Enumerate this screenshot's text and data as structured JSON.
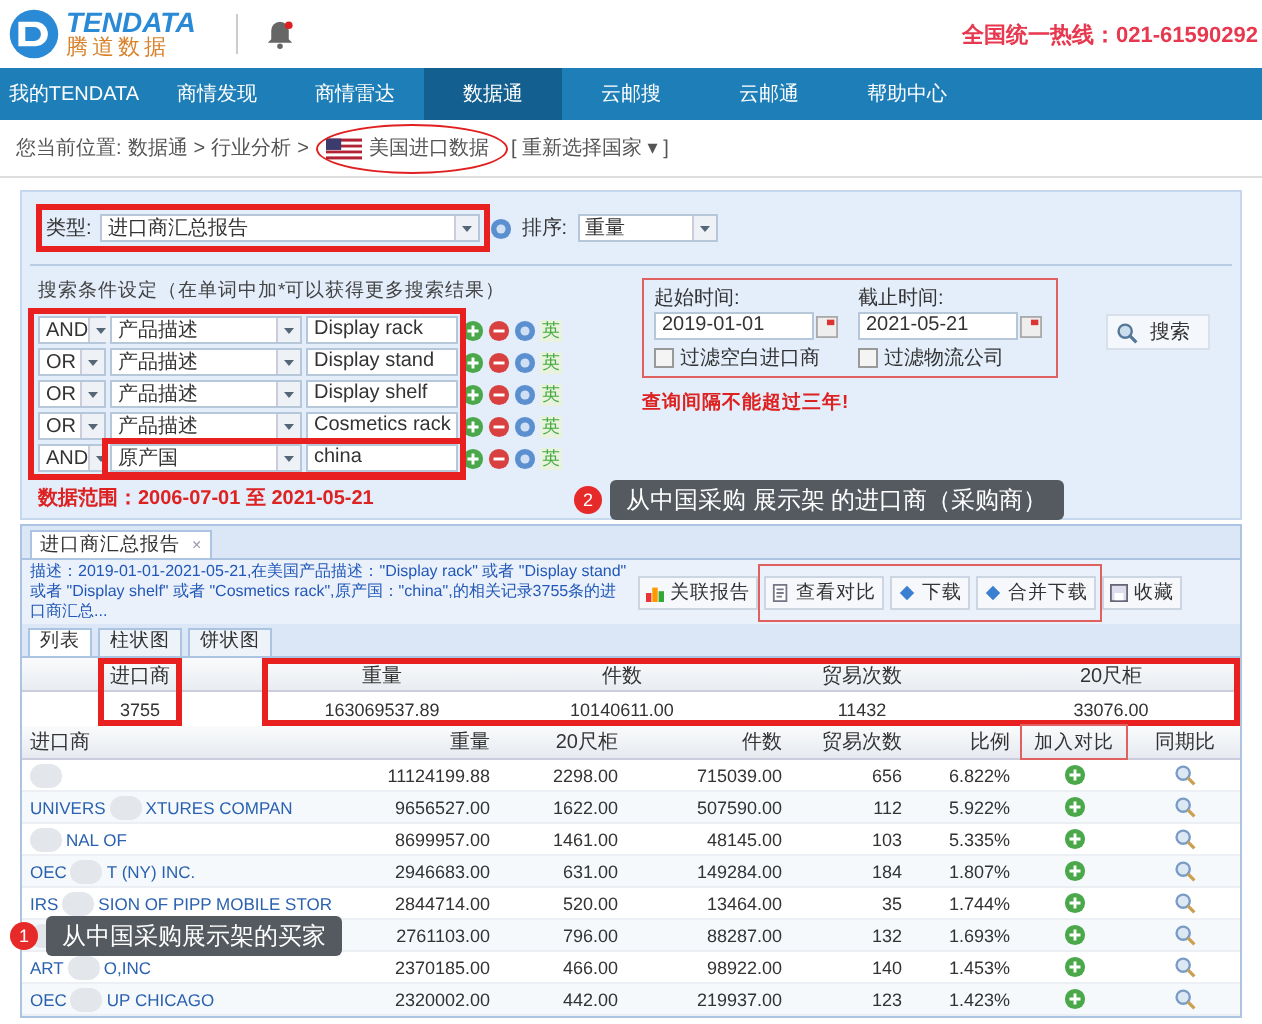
{
  "header": {
    "logo_en": "TENDATA",
    "logo_cn": "腾道数据",
    "hotline": "全国统一热线：021-61590292"
  },
  "nav": [
    {
      "label": "我的TENDATA",
      "selected": false
    },
    {
      "label": "商情发现",
      "selected": false
    },
    {
      "label": "商情雷达",
      "selected": false
    },
    {
      "label": "数据通",
      "selected": true
    },
    {
      "label": "云邮搜",
      "selected": false
    },
    {
      "label": "云邮通",
      "selected": false
    },
    {
      "label": "帮助中心",
      "selected": false
    }
  ],
  "breadcrumb": [
    {
      "kind": "text",
      "text": "您当前位置:"
    },
    {
      "kind": "link",
      "text": "数据通"
    },
    {
      "kind": "text",
      "text": ">"
    },
    {
      "kind": "link",
      "text": "行业分析"
    },
    {
      "kind": "text",
      "text": ">"
    },
    {
      "kind": "flag"
    },
    {
      "kind": "text",
      "text": "美国进口数据"
    },
    {
      "kind": "link",
      "text": "[ 重新选择国家 ▾ ]"
    }
  ],
  "filters": {
    "type_label": "类型:",
    "type_value": "进口商汇总报告",
    "sort_label": "排序:",
    "sort_value": "重量"
  },
  "conditions": {
    "title": "搜索条件设定（在单词中加*可以获得更多搜索结果）",
    "rows": [
      {
        "logic": "AND",
        "field": "产品描述",
        "value": "Display rack",
        "lang": "英"
      },
      {
        "logic": "OR",
        "field": "产品描述",
        "value": "Display stand",
        "lang": "英"
      },
      {
        "logic": "OR",
        "field": "产品描述",
        "value": "Display shelf",
        "lang": "英"
      },
      {
        "logic": "OR",
        "field": "产品描述",
        "value": "Cosmetics rack",
        "lang": "英"
      },
      {
        "logic": "AND",
        "field": "原产国",
        "value": "china",
        "lang": "英"
      }
    ]
  },
  "dates": {
    "start_label": "起始时间:",
    "start": "2019-01-01",
    "end_label": "截止时间:",
    "end": "2021-05-21",
    "options": [
      {
        "label": "过滤空白进口商",
        "checked": false
      },
      {
        "label": "过滤物流公司",
        "checked": false
      }
    ],
    "warning": "查询间隔不能超过三年!"
  },
  "search_button": "搜索",
  "data_range": "数据范围：2006-07-01 至 2021-05-21",
  "report": {
    "tab": "进口商汇总报告",
    "close": "×",
    "description": "描述：2019-01-01-2021-05-21,在美国产品描述：\"Display rack\" 或者 \"Display stand\" 或者 \"Display shelf\" 或者 \"Cosmetics rack\",原产国：\"china\",的相关记录3755条的进口商汇总...",
    "buttons": [
      {
        "label": "关联报告",
        "kind": "chart"
      },
      {
        "label": "查看对比",
        "kind": "doc"
      },
      {
        "label": "下载",
        "kind": "download"
      },
      {
        "label": "合并下载",
        "kind": "download"
      },
      {
        "label": "收藏",
        "kind": "save"
      }
    ]
  },
  "view_tabs": [
    {
      "label": "列表",
      "selected": true
    },
    {
      "label": "柱状图",
      "selected": false
    },
    {
      "label": "饼状图",
      "selected": false
    }
  ],
  "summary": {
    "columns": [
      "进口商",
      "重量",
      "件数",
      "贸易次数",
      "20尺柜"
    ],
    "values": [
      "3755",
      "163069537.89",
      "10140611.00",
      "11432",
      "33076.00"
    ]
  },
  "table": {
    "columns": [
      "进口商",
      "重量",
      "20尺柜",
      "件数",
      "贸易次数",
      "比例",
      "加入对比",
      "同期比"
    ],
    "rows": [
      {
        "weight": "11124199.88",
        "teu": "2298.00",
        "pieces": "715039.00",
        "trades": "656",
        "share": "6.822%"
      },
      {
        "name_start": "UNIVERS",
        "name_end": "XTURES COMPAN",
        "weight": "9656527.00",
        "teu": "1622.00",
        "pieces": "507590.00",
        "trades": "112",
        "share": "5.922%"
      },
      {
        "name_end": "NAL OF",
        "weight": "8699957.00",
        "teu": "1461.00",
        "pieces": "48145.00",
        "trades": "103",
        "share": "5.335%"
      },
      {
        "name_start": "OEC",
        "name_end": "T (NY) INC.",
        "weight": "2946683.00",
        "teu": "631.00",
        "pieces": "149284.00",
        "trades": "184",
        "share": "1.807%"
      },
      {
        "name_start": "IRS",
        "name_end": "SION OF PIPP MOBILE STOR",
        "weight": "2844714.00",
        "teu": "520.00",
        "pieces": "13464.00",
        "trades": "35",
        "share": "1.744%"
      },
      {
        "weight": "2761103.00",
        "teu": "796.00",
        "pieces": "88287.00",
        "trades": "132",
        "share": "1.693%"
      },
      {
        "name_start": "ART",
        "name_end": "O,INC",
        "weight": "2370185.00",
        "teu": "466.00",
        "pieces": "98922.00",
        "trades": "140",
        "share": "1.453%"
      },
      {
        "name_start": "OEC",
        "name_end": "UP CHICAGO",
        "weight": "2320002.00",
        "teu": "442.00",
        "pieces": "219937.00",
        "trades": "123",
        "share": "1.423%"
      }
    ]
  },
  "annotations": [
    {
      "number": "2",
      "text": "从中国采购 展示架 的进口商（采购商）"
    },
    {
      "number": "1",
      "text": "从中国采购展示架的买家"
    }
  ]
}
